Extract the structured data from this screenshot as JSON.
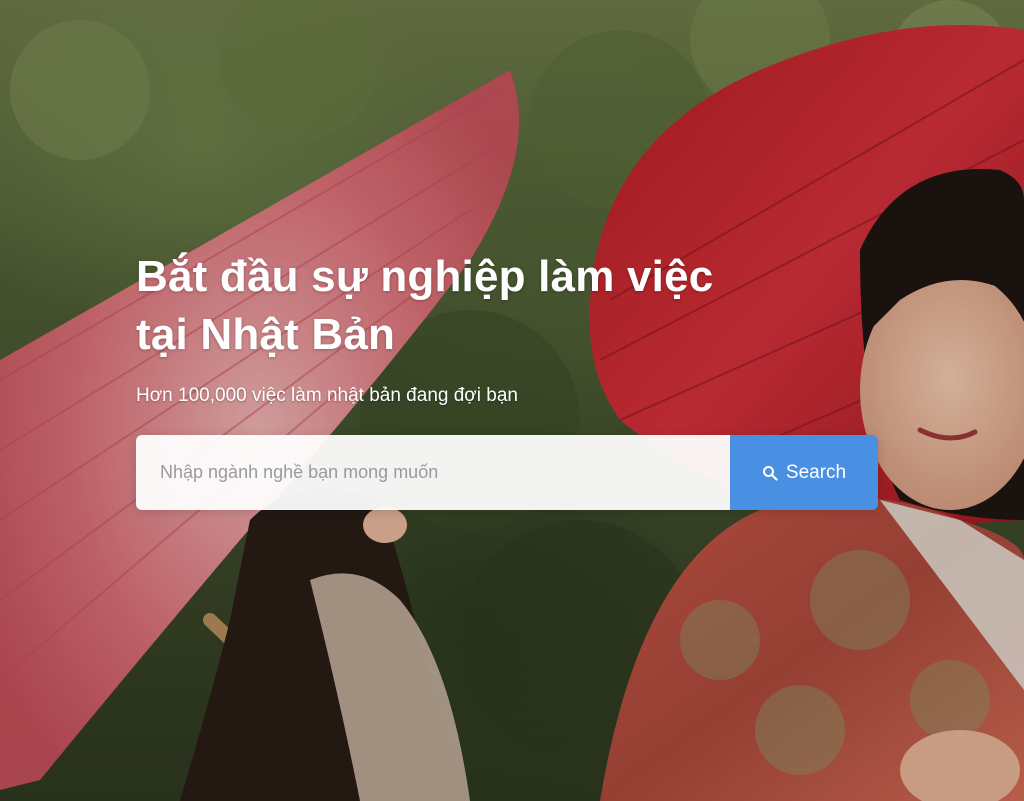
{
  "hero": {
    "headline_line1": "Bắt đầu sự nghiệp làm việc",
    "headline_line2": "tại Nhật Bản",
    "subtitle": "Hơn 100,000 việc làm nhật bản đang đợi bạn",
    "background_image": "two women in red kimonos holding red paper umbrellas in front of green foliage"
  },
  "search": {
    "placeholder": "Nhập ngành nghề bạn mong muốn",
    "value": "",
    "button_label": "Search",
    "button_icon": "search-icon"
  },
  "colors": {
    "accent": "#4a90e2",
    "headline_text": "#ffffff",
    "umbrella_red": "#c8282e"
  }
}
